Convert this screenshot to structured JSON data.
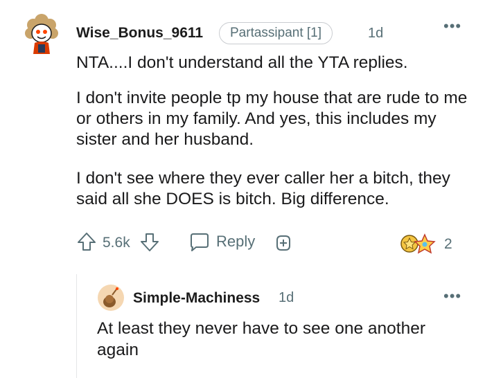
{
  "comment": {
    "author": "Wise_Bonus_9611",
    "flair": "Partassipant [1]",
    "age": "1d",
    "more": "•••",
    "paragraphs": [
      "NTA....I don't understand all the YTA replies.",
      "I don't invite people tp my house that are rude to me or others in my family. And yes, this includes my sister and her husband.",
      "I don't see where they ever caller her a bitch, they said all she DOES is bitch. Big difference."
    ],
    "actions": {
      "upvote_icon": "upvote-arrow-icon",
      "vote_count": "5.6k",
      "downvote_icon": "downvote-arrow-icon",
      "reply_label": "Reply",
      "award_icon": "add-award-icon",
      "award_count": "2"
    }
  },
  "reply": {
    "author": "Simple-Machiness",
    "age": "1d",
    "more": "•••",
    "text": "At least they never have to see one another again"
  },
  "colors": {
    "text": "#1a1a1b",
    "meta": "#576f76",
    "thread_line": "#e5e6e8",
    "flair_border": "#c9ccd0"
  }
}
